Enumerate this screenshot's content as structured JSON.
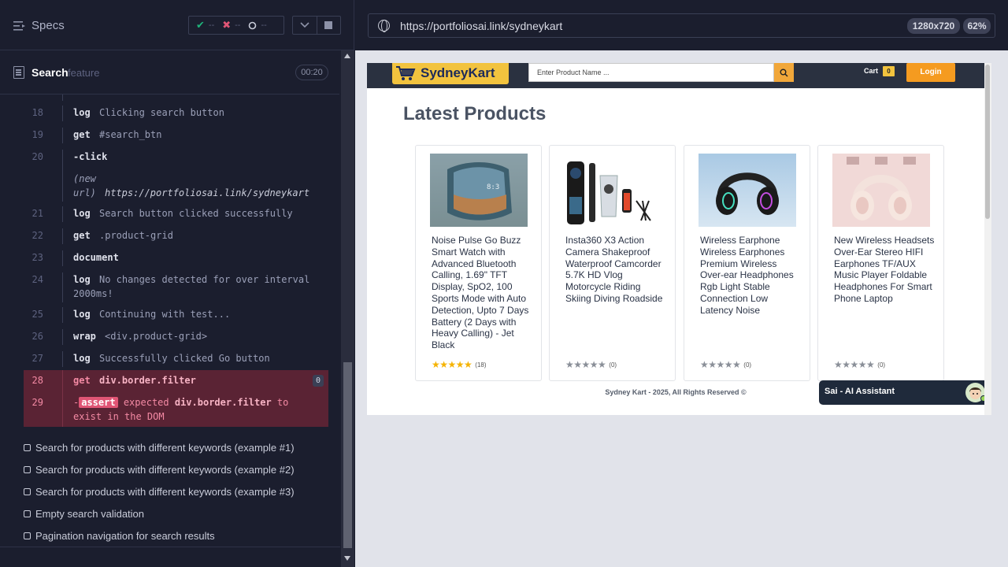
{
  "runner": {
    "specs_label": "Specs",
    "stats": {
      "passed": "--",
      "failed": "--",
      "pending": "--"
    },
    "search": {
      "title": "Search",
      "subtitle": "feature",
      "duration": "00:20"
    },
    "commands": [
      {
        "num": "18",
        "name": "log",
        "msg": "Clicking search button"
      },
      {
        "num": "19",
        "name": "get",
        "msg": "#search_btn"
      },
      {
        "num": "20",
        "name": "-click",
        "msg": ""
      },
      {
        "num": "",
        "name": "",
        "msg": ""
      },
      {
        "num": "21",
        "name": "log",
        "msg": "Search button clicked successfully"
      },
      {
        "num": "22",
        "name": "get",
        "msg": ".product-grid"
      },
      {
        "num": "23",
        "name": "document",
        "msg": ""
      },
      {
        "num": "24",
        "name": "log",
        "msg": "No changes detected for over interval",
        "msg2": "2000ms!"
      },
      {
        "num": "25",
        "name": "log",
        "msg": "Continuing with test..."
      },
      {
        "num": "26",
        "name": "wrap",
        "msg": "<div.product-grid>"
      },
      {
        "num": "27",
        "name": "log",
        "msg": "Successfully clicked Go button"
      },
      {
        "num": "28",
        "name": "get",
        "msg": "div.border.filter",
        "badge": "0"
      },
      {
        "num": "29",
        "name": "-",
        "msg": ""
      }
    ],
    "new_url": {
      "label_1": "(new",
      "label_2": "url)",
      "url": "https://portfoliosai.link/sydneykart"
    },
    "assert": {
      "tag": "assert",
      "pre": "expected",
      "target": "div.border.filter",
      "post": "to",
      "line2": "exist in the DOM"
    },
    "tests": [
      "Search for products with different keywords (example #1)",
      "Search for products with different keywords (example #2)",
      "Search for products with different keywords (example #3)",
      "Empty search validation",
      "Pagination navigation for search results"
    ]
  },
  "preview": {
    "url": "https://portfoliosai.link/sydneykart",
    "viewport": "1280x720",
    "zoom": "62%"
  },
  "site": {
    "brand": "SydneyKart",
    "search_placeholder": "Enter Product Name ...",
    "cart_label": "Cart",
    "cart_count": "0",
    "login_label": "Login",
    "heading": "Latest Products",
    "products": [
      {
        "title": "Noise Pulse Go Buzz Smart Watch with Advanced Bluetooth Calling, 1.69\" TFT Display, SpO2, 100 Sports Mode with Auto Detection, Upto 7 Days Battery (2 Days with Heavy Calling) - Jet Black",
        "rating": 4.5,
        "count": "(18)"
      },
      {
        "title": "Insta360 X3 Action Camera Shakeproof Waterproof Camcorder 5.7K HD Vlog Motorcycle Riding Skiing Diving Roadside",
        "rating": 0,
        "count": "(0)"
      },
      {
        "title": "Wireless Earphone Wireless Earphones Premium Wireless Over-ear Headphones Rgb Light Stable Connection Low Latency Noise",
        "rating": 0,
        "count": "(0)"
      },
      {
        "title": "New Wireless Headsets Over-Ear Stereo HIFI Earphones TF/AUX Music Player Foldable Headphones For Smart Phone Laptop",
        "rating": 0,
        "count": "(0)"
      }
    ],
    "footer": "Sydney Kart - 2025, All Rights Reserved ©",
    "assistant": "Sai - AI Assistant"
  },
  "colors": {
    "runner_bg": "#1b1e2e",
    "fail_bg": "#5a2334",
    "fail_text": "#f48aa4",
    "brand_yellow": "#f2c33e",
    "login_orange": "#f59b20",
    "star_filled": "#f5b301",
    "star_empty": "#8a8f98"
  }
}
